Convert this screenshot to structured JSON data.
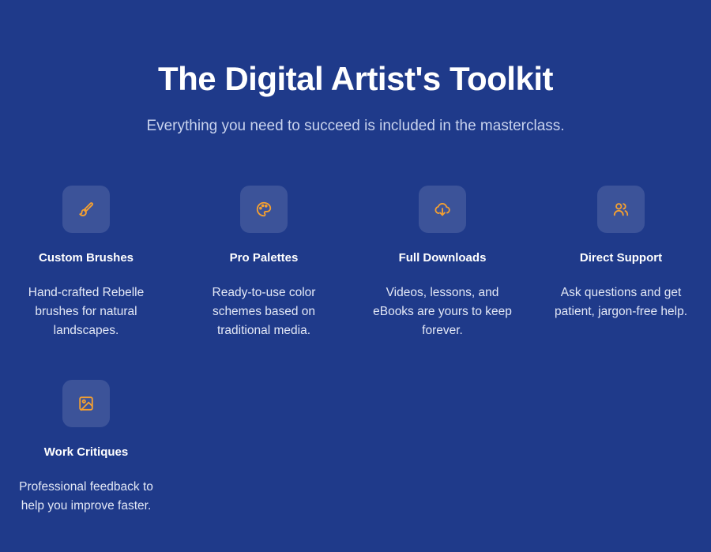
{
  "header": {
    "title": "The Digital Artist's Toolkit",
    "subtitle": "Everything you need to succeed is included in the masterclass."
  },
  "features": [
    {
      "icon": "paintbrush-icon",
      "title": "Custom Brushes",
      "description": "Hand-crafted Rebelle brushes for natural landscapes."
    },
    {
      "icon": "palette-icon",
      "title": "Pro Palettes",
      "description": "Ready-to-use color schemes based on traditional media."
    },
    {
      "icon": "cloud-download-icon",
      "title": "Full Downloads",
      "description": "Videos, lessons, and eBooks are yours to keep forever."
    },
    {
      "icon": "users-icon",
      "title": "Direct Support",
      "description": "Ask questions and get patient, jargon-free help."
    },
    {
      "icon": "image-icon",
      "title": "Work Critiques",
      "description": "Professional feedback to help you improve faster."
    }
  ],
  "colors": {
    "background": "#1f3a8a",
    "icon_accent": "#f5a030",
    "icon_tile": "rgba(255,255,255,0.13)",
    "subtitle_text": "#c9d3ee"
  }
}
